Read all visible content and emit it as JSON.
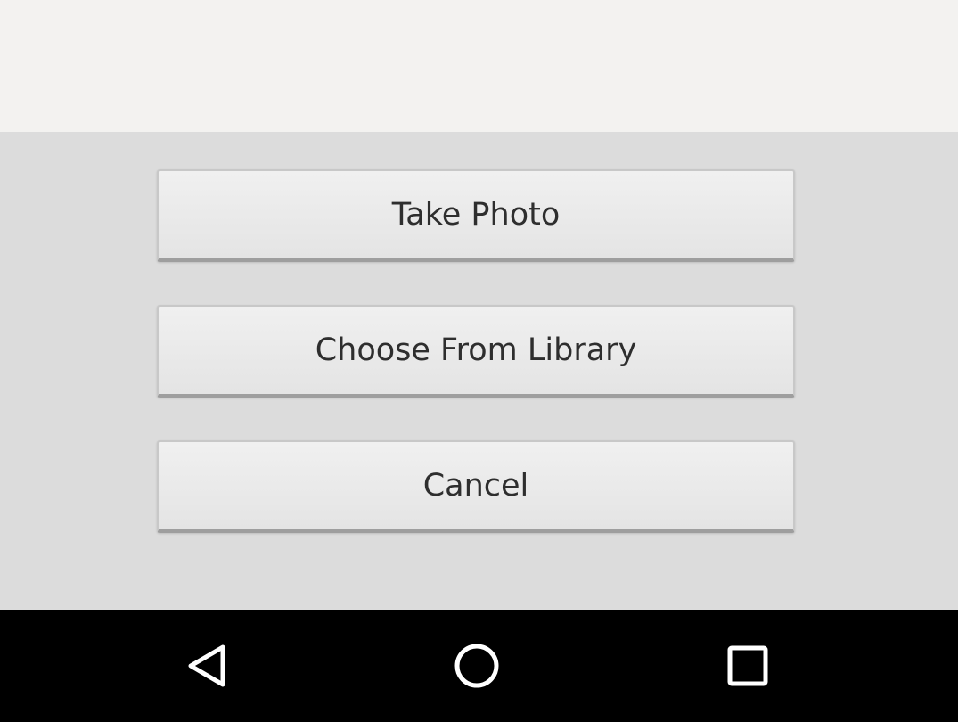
{
  "dialog": {
    "take_photo_label": "Take Photo",
    "choose_library_label": "Choose From Library",
    "cancel_label": "Cancel"
  },
  "navbar": {
    "back_icon": "back-triangle-icon",
    "home_icon": "home-circle-icon",
    "recents_icon": "recents-square-icon"
  },
  "colors": {
    "top_background": "#f3f2f0",
    "sheet_background": "#dcdcdc",
    "button_text": "#2e2e2e",
    "navbar_background": "#000000",
    "navbar_icon": "#ffffff"
  }
}
